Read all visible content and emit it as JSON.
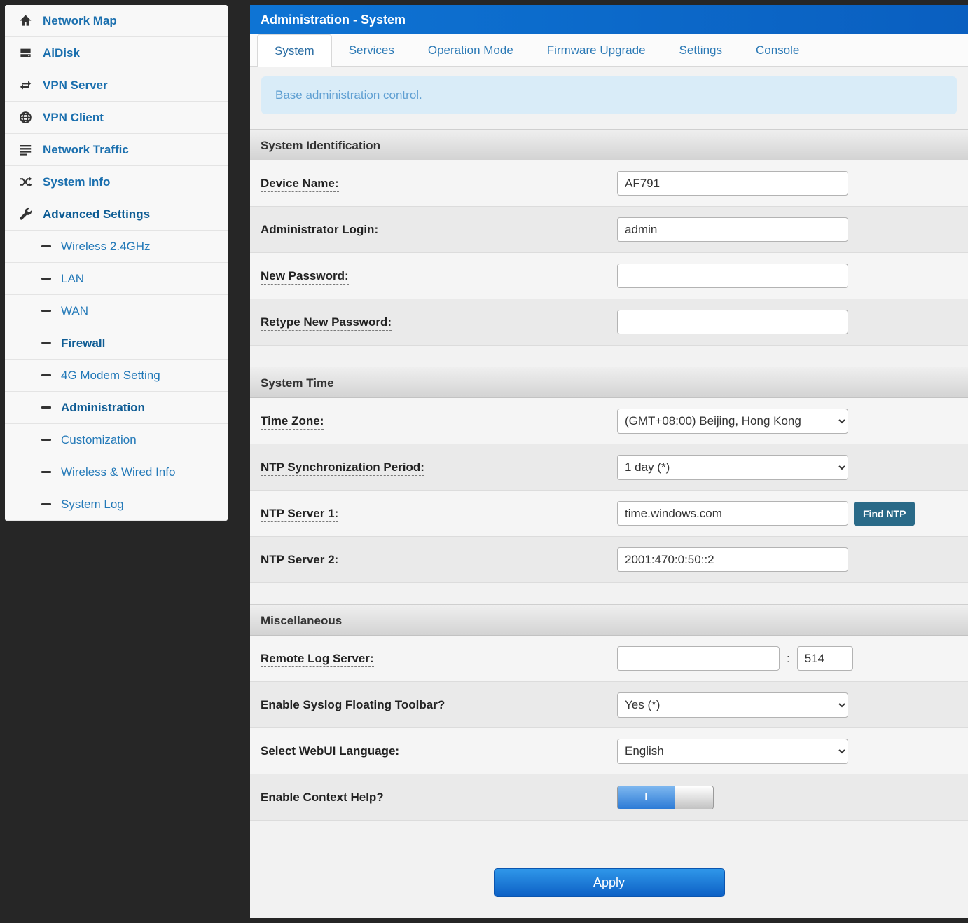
{
  "sidebar": {
    "items": [
      {
        "label": "Network Map"
      },
      {
        "label": "AiDisk"
      },
      {
        "label": "VPN Server"
      },
      {
        "label": "VPN Client"
      },
      {
        "label": "Network Traffic"
      },
      {
        "label": "System Info"
      },
      {
        "label": "Advanced Settings"
      }
    ],
    "subitems": [
      {
        "label": "Wireless 2.4GHz"
      },
      {
        "label": "LAN"
      },
      {
        "label": "WAN"
      },
      {
        "label": "Firewall"
      },
      {
        "label": "4G Modem Setting"
      },
      {
        "label": "Administration"
      },
      {
        "label": "Customization"
      },
      {
        "label": "Wireless & Wired Info"
      },
      {
        "label": "System Log"
      }
    ]
  },
  "header": {
    "title": "Administration - System"
  },
  "tabs": [
    {
      "label": "System"
    },
    {
      "label": "Services"
    },
    {
      "label": "Operation Mode"
    },
    {
      "label": "Firmware Upgrade"
    },
    {
      "label": "Settings"
    },
    {
      "label": "Console"
    }
  ],
  "info": {
    "text": "Base administration control."
  },
  "sections": {
    "identification": {
      "title": "System Identification"
    },
    "time": {
      "title": "System Time"
    },
    "misc": {
      "title": "Miscellaneous"
    }
  },
  "form": {
    "device_name": {
      "label": "Device Name:",
      "value": "AF791"
    },
    "admin_login": {
      "label": "Administrator Login:",
      "value": "admin"
    },
    "new_password": {
      "label": "New Password:",
      "value": ""
    },
    "retype_password": {
      "label": "Retype New Password:",
      "value": ""
    },
    "time_zone": {
      "label": "Time Zone:",
      "selected": "(GMT+08:00) Beijing, Hong Kong"
    },
    "ntp_period": {
      "label": "NTP Synchronization Period:",
      "selected": "1 day (*)"
    },
    "ntp_server1": {
      "label": "NTP Server 1:",
      "value": "time.windows.com",
      "button": "Find NTP"
    },
    "ntp_server2": {
      "label": "NTP Server 2:",
      "value": "2001:470:0:50::2"
    },
    "remote_log": {
      "label": "Remote Log Server:",
      "host": "",
      "separator": ":",
      "port": "514"
    },
    "syslog_toolbar": {
      "label": "Enable Syslog Floating Toolbar?",
      "selected": "Yes (*)"
    },
    "webui_language": {
      "label": "Select WebUI Language:",
      "selected": "English"
    },
    "context_help": {
      "label": "Enable Context Help?",
      "state": "on",
      "on_label": "I"
    },
    "apply_label": "Apply"
  },
  "colors": {
    "header_blue": "#0e74d4",
    "link_blue": "#2379b8",
    "info_bg": "#d9ecf8",
    "find_ntp_bg": "#2a6a88",
    "apply_top": "#2f97e9",
    "apply_bottom": "#0d60c5"
  }
}
